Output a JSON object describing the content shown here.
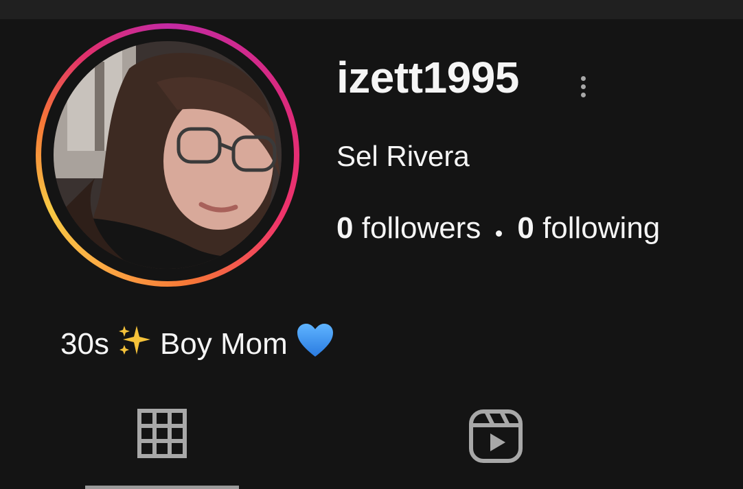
{
  "profile": {
    "username": "izett1995",
    "display_name": "Sel Rivera",
    "followers_count": "0",
    "followers_label": "followers",
    "following_count": "0",
    "following_label": "following",
    "bio": {
      "prefix": "30s",
      "sparkles_icon": "sparkles-emoji",
      "middle": "Boy Mom",
      "heart_icon": "blue-heart-emoji"
    },
    "story_ring_colors": [
      "#c32aa3",
      "#e1306c",
      "#f77737",
      "#fcaf45"
    ]
  },
  "header": {
    "more_icon": "more-vertical-icon"
  },
  "tabs": [
    {
      "name": "posts",
      "icon": "grid-icon",
      "active": true
    },
    {
      "name": "reels",
      "icon": "reels-icon",
      "active": false
    }
  ],
  "colors": {
    "background": "#141414",
    "text": "#f5f5f5",
    "icon_muted": "#a8a8a8"
  }
}
